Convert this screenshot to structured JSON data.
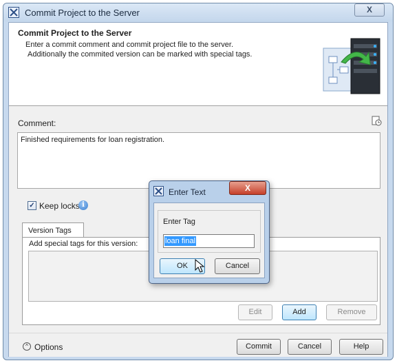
{
  "window": {
    "title": "Commit Project to the Server",
    "close_label": "X"
  },
  "header": {
    "title": "Commit Project to the Server",
    "desc_line1": "Enter a commit comment and commit project file to the server.",
    "desc_line2": "Additionally the commited version can be marked with special tags."
  },
  "comment": {
    "label": "Comment:",
    "value": "Finished requirements for loan registration."
  },
  "keep_locks": {
    "label": "Keep locks",
    "checked": true
  },
  "tabs": {
    "version_tags": "Version Tags",
    "instruction": "Add special tags for this version:",
    "tags": []
  },
  "tag_buttons": {
    "edit": "Edit",
    "add": "Add",
    "remove": "Remove"
  },
  "footer": {
    "options_label": "Options",
    "commit": "Commit",
    "cancel": "Cancel",
    "help": "Help"
  },
  "enter_text_dialog": {
    "title": "Enter Text",
    "close_label": "X",
    "group_label": "Enter Tag",
    "input_value": "loan final",
    "ok": "OK",
    "cancel": "Cancel"
  },
  "colors": {
    "title_bar": "#c4d7ec",
    "selection": "#3399ff",
    "default_button": "#bee6fd",
    "close_red": "#c5402a"
  }
}
